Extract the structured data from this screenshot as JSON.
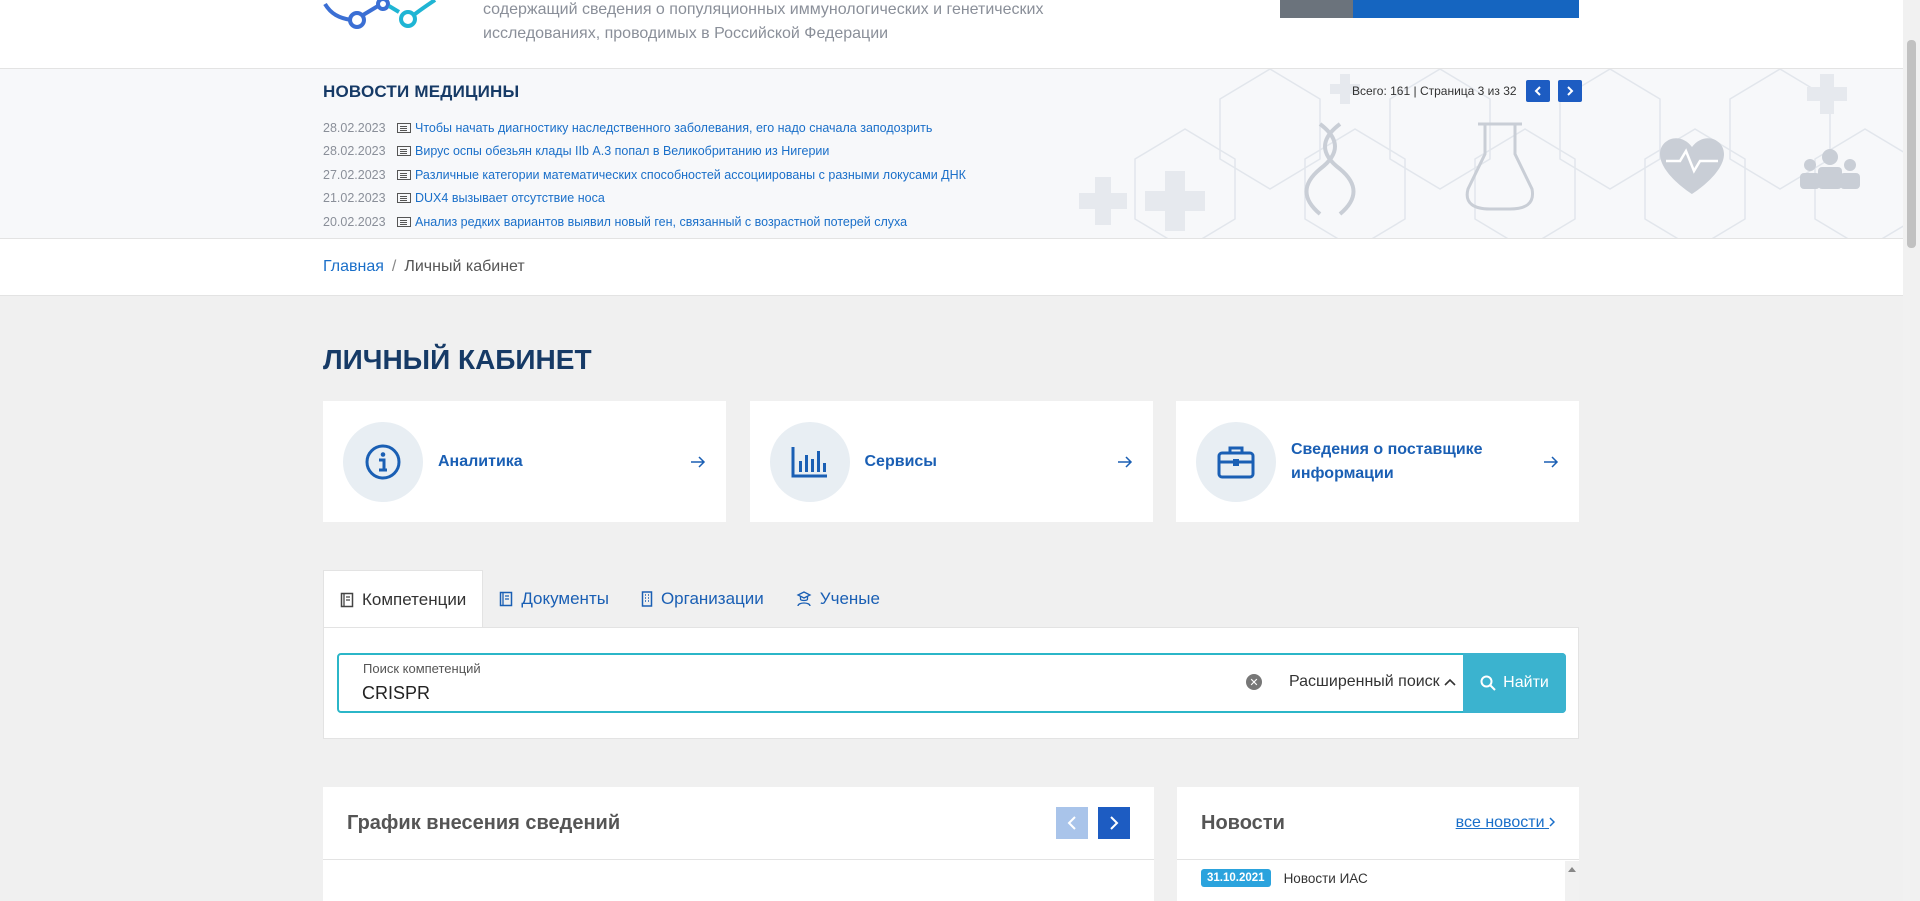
{
  "header": {
    "description": "содержащий сведения о популяционных иммунологических и генетических исследованиях, проводимых в Российской Федерации"
  },
  "news": {
    "title": "НОВОСТИ МЕДИЦИНЫ",
    "pager_text": "Всего: 161 | Страница 3 из 32",
    "items": [
      {
        "date": "28.02.2023",
        "title": "Чтобы начать диагностику наследственного заболевания, его надо сначала заподозрить"
      },
      {
        "date": "28.02.2023",
        "title": "Вирус оспы обезьян клады IIb А.3 попал в Великобританию из Нигерии"
      },
      {
        "date": "27.02.2023",
        "title": "Различные категории математических способностей ассоциированы с разными локусами ДНК"
      },
      {
        "date": "21.02.2023",
        "title": "DUX4 вызывает отсутствие носа"
      },
      {
        "date": "20.02.2023",
        "title": "Анализ редких вариантов выявил новый ген, связанный с возрастной потерей слуха"
      }
    ]
  },
  "breadcrumb": {
    "home": "Главная",
    "separator": "/",
    "current": "Личный кабинет"
  },
  "page": {
    "title": "ЛИЧНЫЙ КАБИНЕТ"
  },
  "cards": [
    {
      "label": "Аналитика",
      "icon": "info-icon"
    },
    {
      "label": "Сервисы",
      "icon": "bar-chart-icon"
    },
    {
      "label": "Сведения о поставщике информации",
      "icon": "briefcase-icon"
    }
  ],
  "tabs": [
    {
      "label": "Компетенции",
      "icon": "book-icon",
      "active": true
    },
    {
      "label": "Документы",
      "icon": "document-icon",
      "active": false
    },
    {
      "label": "Организации",
      "icon": "building-icon",
      "active": false
    },
    {
      "label": "Ученые",
      "icon": "scientist-icon",
      "active": false
    }
  ],
  "search": {
    "label": "Поиск компетенций",
    "value": "CRISPR",
    "clear": "✕",
    "advanced": "Расширенный поиск",
    "submit": "Найти"
  },
  "chart_panel": {
    "title": "График внесения сведений"
  },
  "news_panel": {
    "title": "Новости",
    "all_link": "все новости",
    "item": {
      "date": "31.10.2021",
      "title": "Новости ИАС"
    }
  },
  "colors": {
    "primary": "#1a5fb4",
    "accent": "#3bb3cf",
    "title": "#163a66",
    "badge": "#2ba3dd"
  }
}
